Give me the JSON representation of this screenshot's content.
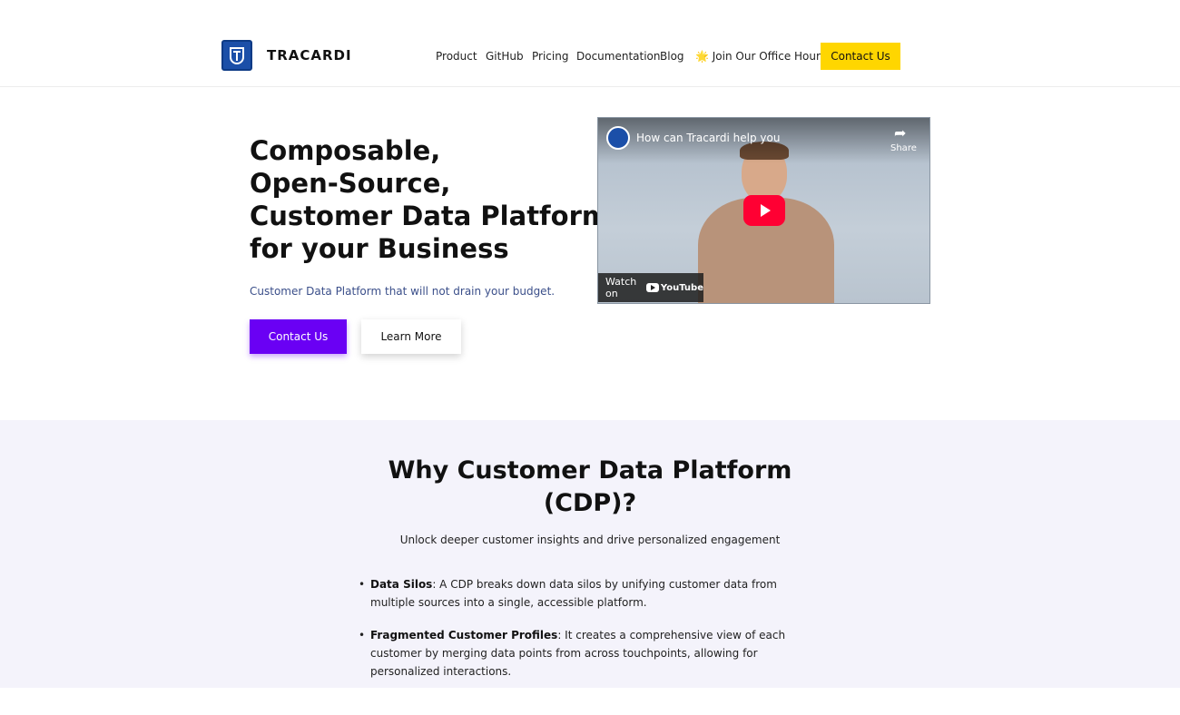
{
  "header": {
    "logo_text": "TRACARDI",
    "nav": [
      {
        "label": "Product"
      },
      {
        "label": "GitHub"
      },
      {
        "label": "Pricing"
      },
      {
        "label": "Documentation"
      },
      {
        "label": "Blog"
      },
      {
        "label": "🌟 Join Our Office Hours"
      }
    ],
    "contact_label": "Contact Us"
  },
  "hero": {
    "title_lines": [
      "Composable,",
      "Open-Source,",
      "Customer Data Platform",
      "for your Business"
    ],
    "subtitle": "Customer Data Platform that will not drain your budget.",
    "primary_button": "Contact Us",
    "secondary_button": "Learn More"
  },
  "video": {
    "title": "How can Tracardi help you",
    "share_label": "Share",
    "watch_on": "Watch on",
    "youtube_label": "YouTube"
  },
  "why": {
    "title": "Why Customer Data Platform (CDP)?",
    "subtitle": "Unlock deeper customer insights and drive personalized engagement",
    "bullets": [
      {
        "term": "Data Silos",
        "text": ": A CDP breaks down data silos by unifying customer data from multiple sources into a single, accessible platform."
      },
      {
        "term": "Fragmented Customer Profiles",
        "text": ": It creates a comprehensive view of each customer by merging data points from across touchpoints, allowing for personalized interactions."
      }
    ]
  },
  "colors": {
    "primary": "#6a00f4",
    "accent": "#ffd600",
    "section_bg": "#f4f3fb",
    "logo_blue": "#1b4fa8"
  }
}
